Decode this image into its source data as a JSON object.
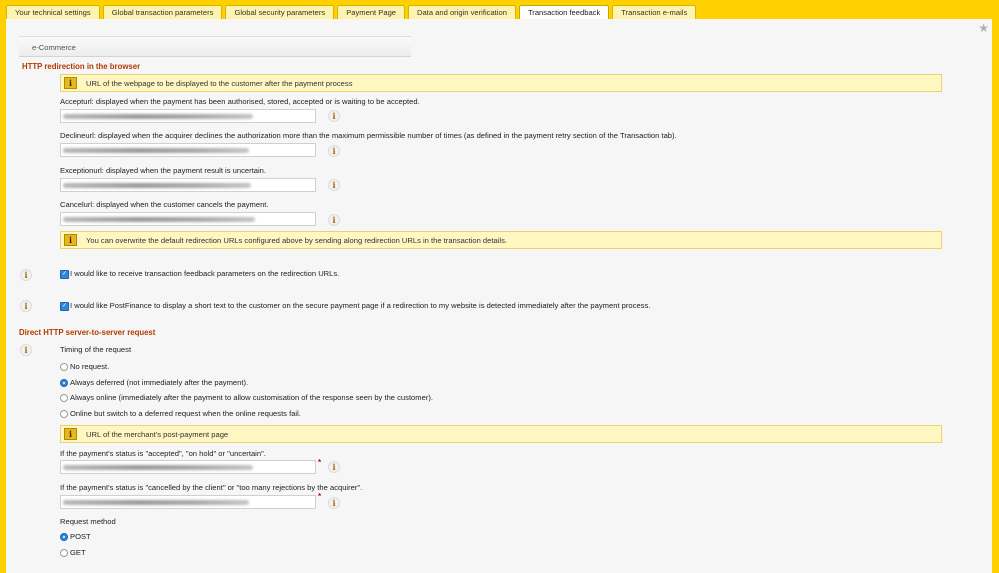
{
  "tabs": [
    {
      "label": "Your technical settings"
    },
    {
      "label": "Global transaction parameters"
    },
    {
      "label": "Global security parameters"
    },
    {
      "label": "Payment Page"
    },
    {
      "label": "Data and origin verification"
    },
    {
      "label": "Transaction feedback"
    },
    {
      "label": "Transaction e-mails"
    }
  ],
  "active_tab": "Transaction feedback",
  "subheader": "e-Commerce",
  "icons": {
    "favorite": "star-icon",
    "info": "info-icon",
    "notice": "warning-info-icon"
  },
  "http_redirect": {
    "title": "HTTP redirection in the browser",
    "notice": "URL of the webpage to be displayed to the customer after the payment process",
    "accept_label": "Accepturl: displayed when the payment has been authorised, stored, accepted or is waiting to be accepted.",
    "decline_label": "Declineurl: displayed when the acquirer declines the authorization more than the maximum permissible number of times (as defined in the payment retry section of the Transaction tab).",
    "exception_label": "Exceptionurl: displayed when the payment result is uncertain.",
    "cancel_label": "Cancelurl: displayed when the customer cancels the payment.",
    "overwrite_notice": "You can overwrite the default redirection URLs configured above by sending along redirection URLs in the transaction details.",
    "feedback_checkbox": "I would like to receive transaction feedback parameters on the redirection URLs.",
    "shorttext_checkbox": "I would like PostFinance to display a short text to the customer on the secure payment page if a redirection to my website is detected immediately after the payment process."
  },
  "server_to_server": {
    "title": "Direct HTTP server-to-server request",
    "timing_label": "Timing of the request",
    "options": [
      {
        "label": "No request.",
        "selected": false
      },
      {
        "label": "Always deferred (not immediately after the payment).",
        "selected": true
      },
      {
        "label": "Always online (immediately after the payment to allow customisation of the response seen by the customer).",
        "selected": false
      },
      {
        "label": "Online but switch to a deferred request when the online requests fail.",
        "selected": false
      }
    ],
    "notice": "URL of the merchant's post-payment page",
    "accepted_label": "If the payment's status is \"accepted\", \"on hold\" or \"uncertain\".",
    "cancelled_label": "If the payment's status is \"cancelled by the client\" or \"too many rejections by the acquirer\".",
    "required_mark": "*",
    "method_label": "Request method",
    "methods": [
      {
        "label": "POST",
        "selected": true
      },
      {
        "label": "GET",
        "selected": false
      }
    ]
  },
  "info_glyph": "i"
}
